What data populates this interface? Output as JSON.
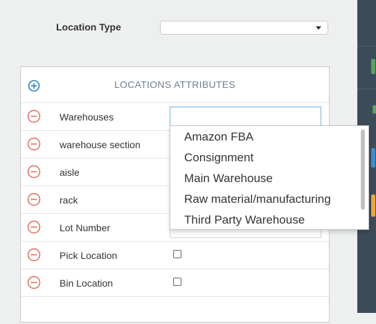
{
  "location_type": {
    "label": "Location Type",
    "value": ""
  },
  "panel": {
    "title": "LOCATIONS ATTRIBUTES",
    "rows": [
      {
        "label": "Warehouses"
      },
      {
        "label": "warehouse section"
      },
      {
        "label": "aisle"
      },
      {
        "label": "rack"
      },
      {
        "label": "Lot Number"
      },
      {
        "label": "Pick Location"
      },
      {
        "label": "Bin Location"
      }
    ]
  },
  "dropdown": {
    "options": [
      "Amazon FBA",
      "Consignment",
      "Main Warehouse",
      "Raw material/manufacturing",
      "Third Party Warehouse"
    ]
  },
  "colors": {
    "accent_blue": "#2f7fc1",
    "remove_red": "#e06b5c",
    "title_gray": "#6c7f94",
    "right_strip": "#3c4b5a"
  }
}
